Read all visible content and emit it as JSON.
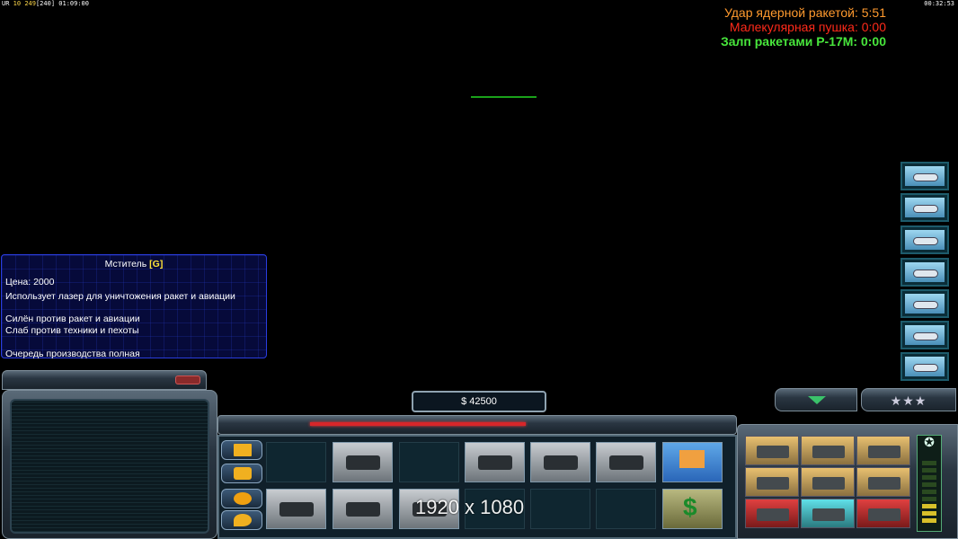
{
  "topbar": {
    "left_prefix": "UR",
    "left_num1": "10",
    "left_num2": "249",
    "left_bracket": "[240]",
    "left_time": "01:09:00",
    "right_time": "00:32:53"
  },
  "timers": [
    {
      "label": "Удар ядерной ракетой: 5:51",
      "color": "#ff9a2e"
    },
    {
      "label": "Малекулярная пушка: 0:00",
      "color": "#ff2a1a"
    },
    {
      "label": "Залп ракетами Р-17М: 0:00",
      "color": "#48e63c"
    }
  ],
  "tooltip": {
    "title": "Мститель",
    "hotkey": "[G]",
    "price": "Цена: 2000",
    "desc": "Использует лазер для уничтожения ракет и авиации",
    "strong": "Силён против ракет и авиации",
    "weak": "Слаб против техники и пехоты",
    "queue": "Очередь производства полная"
  },
  "money": "$ 42500",
  "overlay_text": "1920 x 1080",
  "tab_stars": "★★★"
}
